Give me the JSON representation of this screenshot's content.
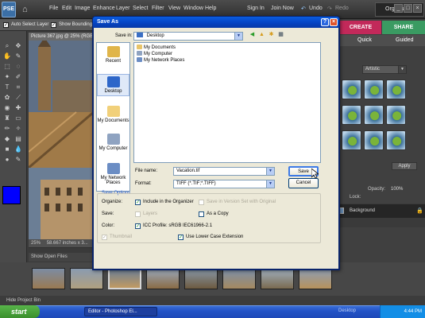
{
  "app": {
    "logo": "PSE",
    "menu": [
      "File",
      "Edit",
      "Image",
      "Enhance",
      "Layer",
      "Select",
      "Filter",
      "View",
      "Window",
      "Help"
    ],
    "account": [
      "Sign In",
      "Join Now"
    ],
    "undo_label": "Undo",
    "redo_label": "Redo",
    "organizer_label": "Organizer",
    "options": [
      "Auto Select Layer",
      "Show Bounding Bo"
    ]
  },
  "document": {
    "title": "Picture 367.jpg @ 25% (RGB",
    "zoom": "25%",
    "size": "58.667 inches x 3..."
  },
  "palette": {
    "tabs": [
      "CREATE",
      "SHARE"
    ],
    "subtabs": [
      "Quick",
      "Guided"
    ],
    "style_filter": "Artistic",
    "apply_label": "Apply",
    "opacity_label": "Opacity:",
    "opacity_value": "100%",
    "lock_label": "Lock:",
    "layer_name": "Background"
  },
  "project_bin": {
    "header": "Show Open Files",
    "hide_label": "Hide Project Bin"
  },
  "dialog": {
    "title": "Save As",
    "save_in_label": "Save in:",
    "save_in_value": "Desktop",
    "places": [
      {
        "label": "Recent",
        "icon": "recent-icon"
      },
      {
        "label": "Desktop",
        "icon": "desktop-icon"
      },
      {
        "label": "My Documents",
        "icon": "my-documents-icon"
      },
      {
        "label": "My Computer",
        "icon": "my-computer-icon"
      },
      {
        "label": "My Network Places",
        "icon": "network-places-icon"
      }
    ],
    "files": [
      {
        "name": "My Documents",
        "icon": "folder-icon"
      },
      {
        "name": "My Computer",
        "icon": "computer-icon"
      },
      {
        "name": "My Network Places",
        "icon": "network-icon"
      }
    ],
    "file_name_label": "File name:",
    "file_name_value": "Vacation.tif",
    "format_label": "Format:",
    "format_value": "TIFF (*.TIF;*.TIFF)",
    "save_button": "Save",
    "cancel_button": "Cancel",
    "save_options": {
      "title": "Save Options",
      "organize_label": "Organize:",
      "include_organizer": "Include in the Organizer",
      "include_organizer_checked": true,
      "version_set": "Save in Version Set with Original",
      "version_set_checked": false,
      "save_label": "Save:",
      "layers": "Layers",
      "layers_checked": false,
      "as_copy": "As a Copy",
      "as_copy_checked": false,
      "color_label": "Color:",
      "icc_profile": "ICC Profile:  sRGB IEC61966-2.1",
      "icc_checked": true,
      "thumbnail": "Thumbnail",
      "thumbnail_checked": true,
      "lowercase": "Use Lower Case Extension",
      "lowercase_checked": true
    }
  },
  "taskbar": {
    "start": "start",
    "item": "Editor - Photoshop El...",
    "desktop_label": "Desktop",
    "clock": "4:44 PM"
  },
  "colors": {
    "foreground": "#0000ff",
    "background": "#ffffff",
    "xp_title": "#0542c0",
    "create_tab": "#c2295a",
    "share_tab": "#3a9b62"
  }
}
